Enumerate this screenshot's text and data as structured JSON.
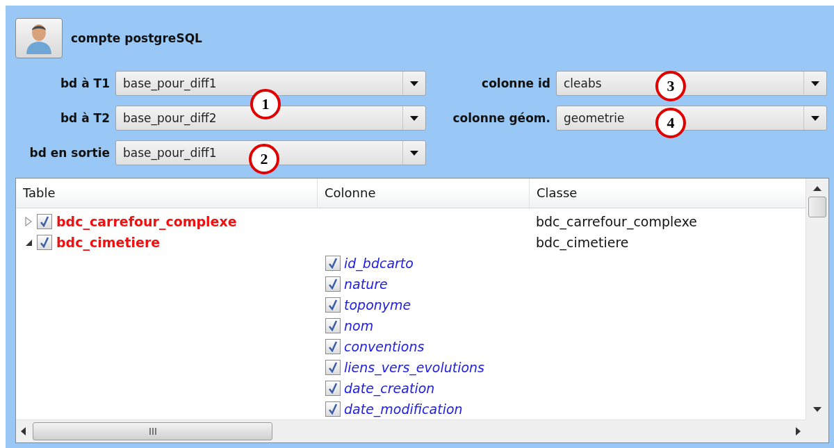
{
  "account_button": {
    "label": "compte postgreSQL"
  },
  "fields": [
    {
      "label": "bd à T1",
      "value": "base_pour_diff1"
    },
    {
      "label": "colonne id",
      "value": "cleabs"
    },
    {
      "label": "bd à T2",
      "value": "base_pour_diff2"
    },
    {
      "label": "colonne géom.",
      "value": "geometrie"
    },
    {
      "label": "bd en sortie",
      "value": "base_pour_diff1"
    }
  ],
  "callouts": [
    {
      "label": "1"
    },
    {
      "label": "2"
    },
    {
      "label": "3"
    },
    {
      "label": "4"
    }
  ],
  "tree": {
    "columns": [
      "Table",
      "Colonne",
      "Classe"
    ],
    "rows": [
      {
        "name": "bdc_carrefour_complexe",
        "checked": true,
        "expanded": false,
        "classe": "bdc_carrefour_complexe"
      },
      {
        "name": "bdc_cimetiere",
        "checked": true,
        "expanded": true,
        "classe": "bdc_cimetiere",
        "children": [
          {
            "name": "id_bdcarto",
            "checked": true
          },
          {
            "name": "nature",
            "checked": true
          },
          {
            "name": "toponyme",
            "checked": true
          },
          {
            "name": "nom",
            "checked": true
          },
          {
            "name": "conventions",
            "checked": true
          },
          {
            "name": "liens_vers_evolutions",
            "checked": true
          },
          {
            "name": "date_creation",
            "checked": true
          },
          {
            "name": "date_modification",
            "checked": true
          }
        ]
      }
    ]
  }
}
